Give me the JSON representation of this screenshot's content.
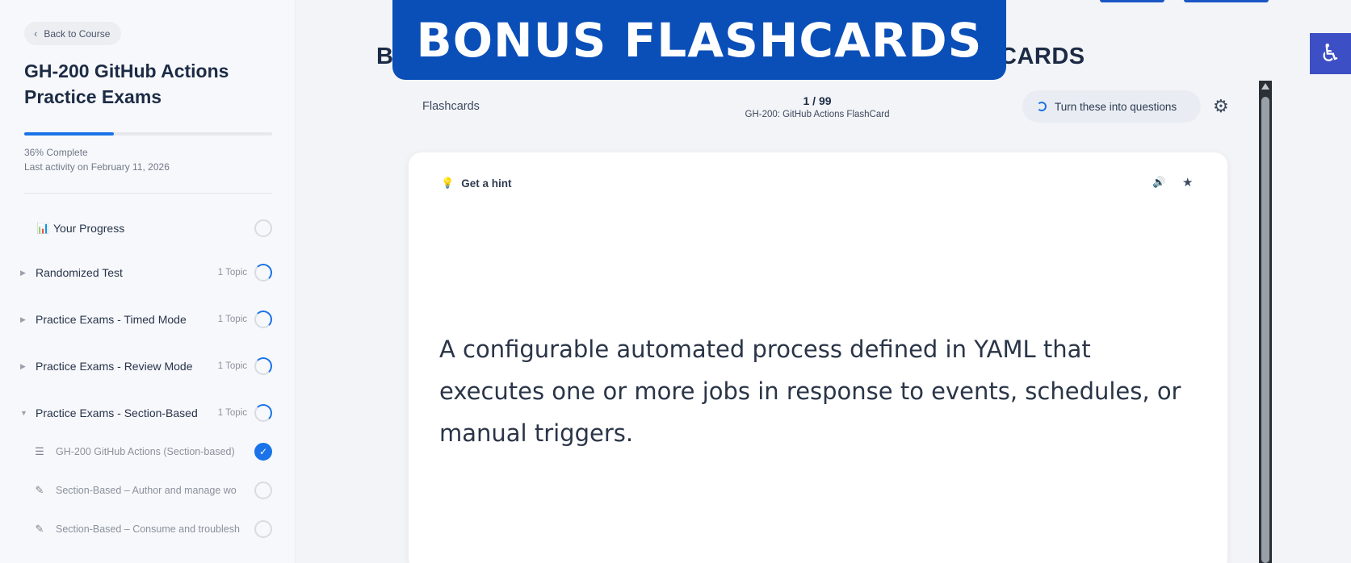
{
  "sidebar": {
    "back_label": "Back to Course",
    "course_title": "GH-200 GitHub Actions Practice Exams",
    "progress_percent": 36,
    "progress_text": "36% Complete",
    "last_activity": "Last activity on February 11, 2026",
    "your_progress_label": "Your Progress",
    "sections": [
      {
        "label": "Randomized Test",
        "topics": "1 Topic"
      },
      {
        "label": "Practice Exams - Timed Mode",
        "topics": "1 Topic"
      },
      {
        "label": "Practice Exams - Review Mode",
        "topics": "1 Topic"
      },
      {
        "label": "Practice Exams - Section-Based",
        "topics": "1 Topic"
      }
    ],
    "sub_items": [
      {
        "label": "GH-200 GitHub Actions (Section-based)"
      },
      {
        "label": "Section-Based – Author and manage wo"
      },
      {
        "label": "Section-Based – Consume and troublesh"
      }
    ]
  },
  "main": {
    "behind_title_left": "B",
    "behind_title_right": "CARDS",
    "banner_text": "BONUS FLASHCARDS",
    "flashcards_label": "Flashcards",
    "counter": "1 / 99",
    "deck_name": "GH-200: GitHub Actions FlashCard",
    "turn_button_label": "Turn these into questions",
    "hint_label": "Get a hint",
    "card_text": "A configurable automated process defined in YAML that executes one or more jobs in response to events, schedules, or manual triggers."
  },
  "colors": {
    "accent": "#1a73e8",
    "banner": "#0a4fb8",
    "accessibility": "#3d4fc4"
  },
  "icons": {
    "back": "chevron-left-icon",
    "progress": "bar-chart-icon",
    "hint": "lightbulb-icon",
    "speaker": "speaker-icon",
    "star": "star-icon",
    "gear": "gear-icon",
    "accessibility": "accessibility-icon"
  }
}
